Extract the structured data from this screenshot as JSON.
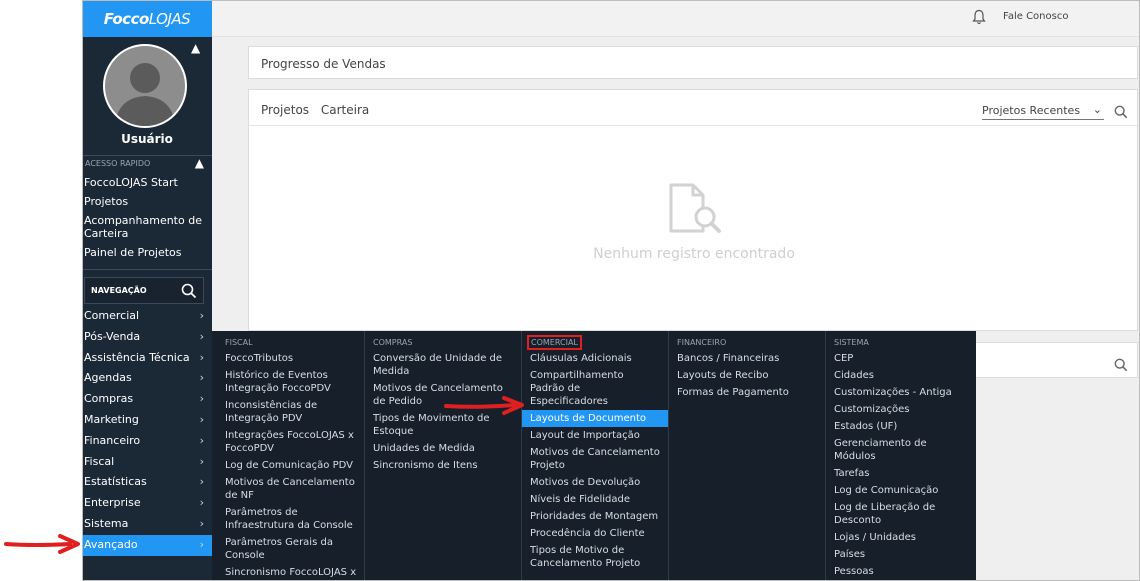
{
  "app": {
    "logo_bold": "Focco",
    "logo_light": "LOJAS"
  },
  "sidebar": {
    "user_name": "Usuário",
    "quick_access_header": "ACESSO RAPIDO",
    "quick_links": [
      "FoccoLOJAS Start",
      "Projetos",
      "Acompanhamento de Carteira",
      "Painel de Projetos"
    ],
    "nav_search_label": "NAVEGAÇÃO",
    "nav_items": [
      "Comercial",
      "Pós-Venda",
      "Assistência Técnica",
      "Agendas",
      "Compras",
      "Marketing",
      "Financeiro",
      "Fiscal",
      "Estatísticas",
      "Enterprise",
      "Sistema",
      "Avançado"
    ],
    "active_item": "Avançado"
  },
  "topbar": {
    "contact": "Fale Conosco"
  },
  "main": {
    "progress_title": "Progresso de Vendas",
    "projects_tabs": [
      "Projetos",
      "Carteira"
    ],
    "recent_select": "Projetos Recentes",
    "empty_message": "Nenhum registro encontrado"
  },
  "mega_menu": {
    "columns": [
      {
        "header": "FISCAL",
        "items": [
          "FoccoTributos",
          "Histórico de Eventos Integração FoccoPDV",
          "Inconsistências de Integração PDV",
          "Integrações FoccoLOJAS x FoccoPDV",
          "Log de Comunicação PDV",
          "Motivos de Cancelamento de NF",
          "Parâmetros de Infraestrutura da Console",
          "Parâmetros Gerais da Console",
          "Sincronismo FoccoLOJAS x"
        ]
      },
      {
        "header": "COMPRAS",
        "items": [
          "Conversão de Unidade de Medida",
          "Motivos de Cancelamento de Pedido",
          "Tipos de Movimento de Estoque",
          "Unidades de Medida",
          "Sincronismo de Itens"
        ]
      },
      {
        "header": "COMERCIAL",
        "items": [
          "Cláusulas Adicionais",
          "Compartilhamento Padrão de Especificadores",
          "Layouts de Documento",
          "Layout de Importação",
          "Motivos de Cancelamento Projeto",
          "Motivos de Devolução",
          "Níveis de Fidelidade",
          "Prioridades de Montagem",
          "Procedência do Cliente",
          "Tipos de Motivo de Cancelamento Projeto"
        ],
        "highlighted": "Layouts de Documento"
      },
      {
        "header": "FINANCEIRO",
        "items": [
          "Bancos / Financeiras",
          "Layouts de Recibo",
          "Formas de Pagamento"
        ]
      },
      {
        "header": "SISTEMA",
        "items": [
          "CEP",
          "Cidades",
          "Customizações - Antiga",
          "Customizações",
          "Estados (UF)",
          "Gerenciamento de Módulos",
          "Tarefas",
          "Log de Comunicação",
          "Log de Liberação de Desconto",
          "Lojas / Unidades",
          "Países",
          "Pessoas"
        ]
      }
    ]
  },
  "colors": {
    "sidebar_bg": "#1b2836",
    "accent": "#2196f3",
    "mega_bg": "#161f2a",
    "annotation_red": "#e02020"
  }
}
